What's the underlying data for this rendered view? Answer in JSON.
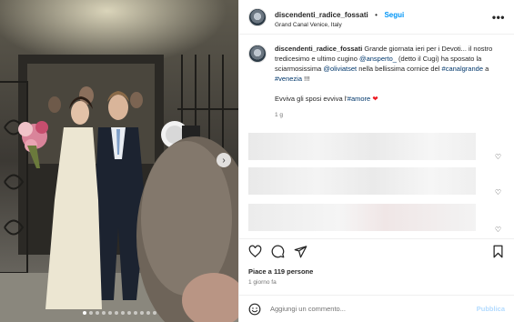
{
  "post": {
    "username": "discendenti_radice_fossati",
    "separator": "•",
    "follow_label": "Segui",
    "location": "Grand Canal Venice, Italy",
    "more_label": "•••",
    "photo_alt": "Wedding photo",
    "carousel_next": "›",
    "carousel_count": 12,
    "carousel_active": 0
  },
  "caption": {
    "username": "discendenti_radice_fossati",
    "text_1": " Grande giornata ieri per i Devoti... il nostro tredicesimo e ultimo cugino ",
    "mention_1": "@ansperto_",
    "text_2": " (detto il Cugi) ha sposato la sciarmosissima ",
    "mention_2": "@oliviatset",
    "text_3": " nella bellissima cornice del ",
    "hashtag_1": "#canalgrande",
    "text_4": " a ",
    "hashtag_2": "#venezia",
    "text_5": " !!!",
    "line_2a": "Evviva gli sposi evviva l'",
    "hashtag_3": "#amore",
    "heart": "❤",
    "age": "1 g"
  },
  "engagement": {
    "likes": "Piace a 119 persone",
    "posted": "1 giorno fa"
  },
  "comment_box": {
    "placeholder": "Aggiungi un commento...",
    "publish_label": "Pubblica"
  },
  "icons": {
    "like": "heart-icon",
    "comment": "comment-icon",
    "share": "share-icon",
    "save": "bookmark-icon",
    "emoji": "emoji-icon",
    "comment_like": "♡"
  },
  "colors": {
    "link": "#00376b",
    "follow": "#0095f6",
    "publish_disabled": "#b3dbff",
    "heart": "#ed1c24"
  }
}
